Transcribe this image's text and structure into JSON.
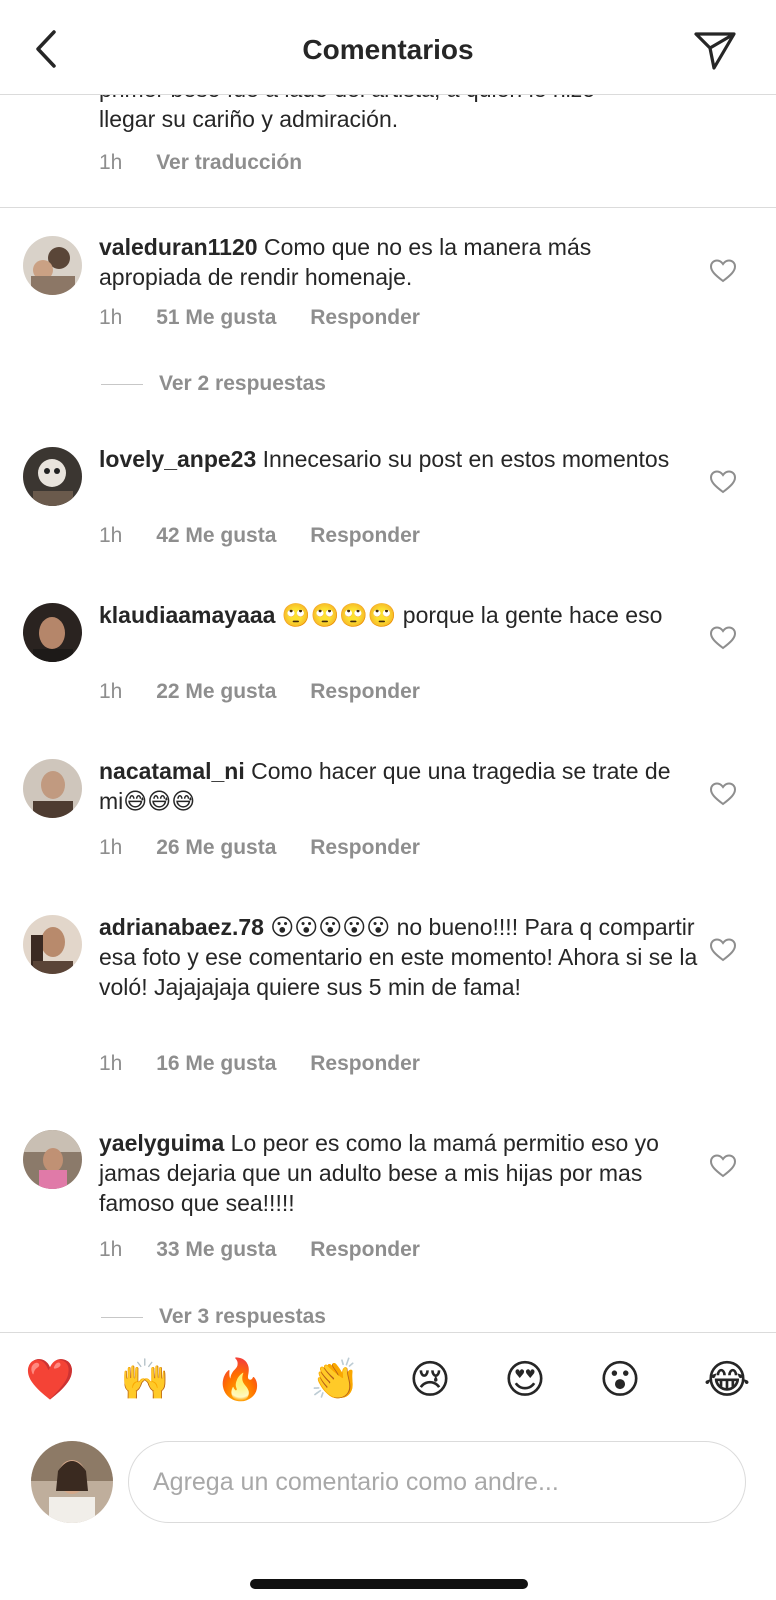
{
  "header": {
    "title": "Comentarios"
  },
  "caption": {
    "text_partial": "primer beso fue a lado del artista, a quien le hizo",
    "text_end": "llegar su cariño y admiración.",
    "time": "1h",
    "translate_label": "Ver traducción"
  },
  "comments": [
    {
      "username": "valeduran1120",
      "text": " Como que no es la manera más apropiada de rendir homenaje.",
      "time": "1h",
      "likes": "51 Me gusta",
      "reply_label": "Responder",
      "replies_label": "Ver 2 respuestas"
    },
    {
      "username": "lovely_anpe23",
      "text": " Innecesario su post en estos momentos",
      "time": "1h",
      "likes": "42 Me gusta",
      "reply_label": "Responder"
    },
    {
      "username": "klaudiaamayaaa",
      "text": " 🙄🙄🙄🙄 porque la gente hace eso",
      "time": "1h",
      "likes": "22 Me gusta",
      "reply_label": "Responder"
    },
    {
      "username": "nacatamal_ni",
      "text": " Como hacer que una tragedia se trate de mi😅😅😅",
      "time": "1h",
      "likes": "26 Me gusta",
      "reply_label": "Responder"
    },
    {
      "username": "adrianabaez.78",
      "text": " 😮😮😮😮😮 no bueno!!!! Para q compartir esa foto y ese comentario en este momento!  Ahora si se la voló! Jajajajaja quiere sus 5 min de fama!",
      "time": "1h",
      "likes": "16 Me gusta",
      "reply_label": "Responder"
    },
    {
      "username": "yaelyguima",
      "text": " Lo peor es como la mamá permitio eso yo jamas dejaria que un adulto bese a mis hijas por mas famoso que sea!!!!!",
      "time": "1h",
      "likes": "33 Me gusta",
      "reply_label": "Responder",
      "replies_label": "Ver 3 respuestas"
    }
  ],
  "emoji_bar": [
    "❤️",
    "🙌",
    "🔥",
    "👏",
    "😢",
    "😍",
    "😮",
    "😂"
  ],
  "compose": {
    "placeholder": "Agrega un comentario como andre..."
  },
  "colors": {
    "text": "#262626",
    "secondary": "#8e8e8e",
    "divider": "#dbdbdb"
  },
  "icons": {
    "back": "chevron-left-icon",
    "send": "paper-plane-icon",
    "like": "heart-outline-icon"
  }
}
